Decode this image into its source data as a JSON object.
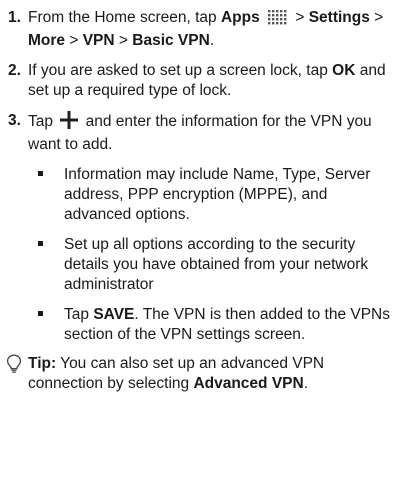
{
  "steps": [
    {
      "num": "1.",
      "t1": "From the Home screen, tap ",
      "apps": "Apps",
      "t2": " > ",
      "settings": "Settings",
      "sep1": " > ",
      "more": "More",
      "sep2": " > ",
      "vpn": "VPN",
      "sep3": " > ",
      "basic_vpn": "Basic VPN",
      "end": "."
    },
    {
      "num": "2.",
      "t1": "If you are asked to set up a screen lock, tap ",
      "ok": "OK",
      "t2": " and set up a required type of lock."
    },
    {
      "num": "3.",
      "t1": "Tap",
      "t2": "and enter the information for the VPN you want to add."
    }
  ],
  "bullets": {
    "b1": "Information may include Name, Type, Server address, PPP encryption (MPPE), and advanced options.",
    "b2": "Set up all options according to the security details you have obtained from your network administrator",
    "b3_pre": "Tap ",
    "b3_save": "SAVE",
    "b3_post": ". The VPN is then added to the VPNs section of the VPN settings screen."
  },
  "tip": {
    "label": "Tip:",
    "text": " You can also set up an advanced VPN connection by selecting ",
    "advanced": "Advanced VPN",
    "end": "."
  },
  "icons": {
    "apps": "apps-grid-icon",
    "plus": "plus-icon",
    "tip": "lightbulb-icon"
  }
}
